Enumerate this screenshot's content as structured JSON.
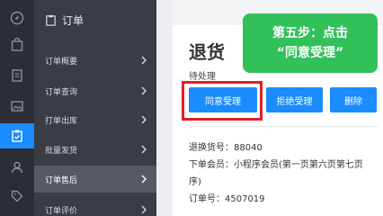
{
  "menu": {
    "header": "订单",
    "items": [
      {
        "label": "订单概要"
      },
      {
        "label": "订单查询"
      },
      {
        "label": "打单出库"
      },
      {
        "label": "批量发货"
      },
      {
        "label": "订单售后"
      },
      {
        "label": "订单评价"
      }
    ]
  },
  "detail": {
    "title": "退货",
    "status": "待处理",
    "buttons": {
      "agree": "同意受理",
      "reject": "拒绝受理",
      "delete": "删除"
    },
    "info": {
      "return_no": "退换货号：88040",
      "member_line1": "下单会员：小程序会员(第一页第六页第七页",
      "member_line2": "序)",
      "order_no": "订单号：4507019"
    }
  },
  "tooltip": {
    "line1": "第五步：点击",
    "line2": "“同意受理”"
  }
}
